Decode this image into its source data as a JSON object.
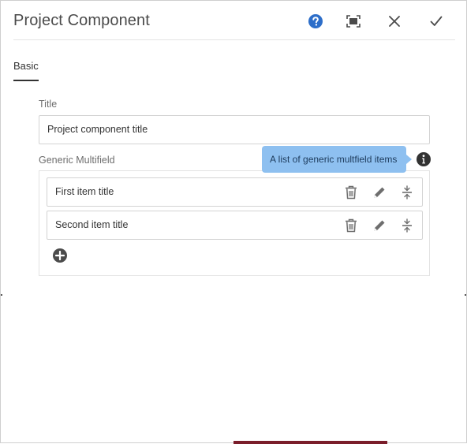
{
  "dialog": {
    "title": "Project Component",
    "header_buttons": [
      {
        "icon": "help-icon",
        "color": "#2d6ec9"
      },
      {
        "icon": "fullscreen-icon"
      },
      {
        "icon": "close-icon"
      },
      {
        "icon": "checkmark-icon"
      }
    ]
  },
  "tabs": [
    {
      "label": "Basic",
      "selected": true
    }
  ],
  "form": {
    "title_field": {
      "label": "Title",
      "value": "Project component title"
    },
    "multifield": {
      "label": "Generic Multifield",
      "tooltip": "A list of generic multfield items",
      "items": [
        {
          "label": "First item title"
        },
        {
          "label": "Second item title"
        }
      ],
      "item_actions": [
        "delete-icon",
        "edit-icon",
        "move-icon"
      ],
      "add_icon": "add-circle-icon"
    }
  },
  "colors": {
    "tooltip_bg": "#8ec0f0",
    "help_icon": "#2d6ec9",
    "text": "#323232"
  }
}
